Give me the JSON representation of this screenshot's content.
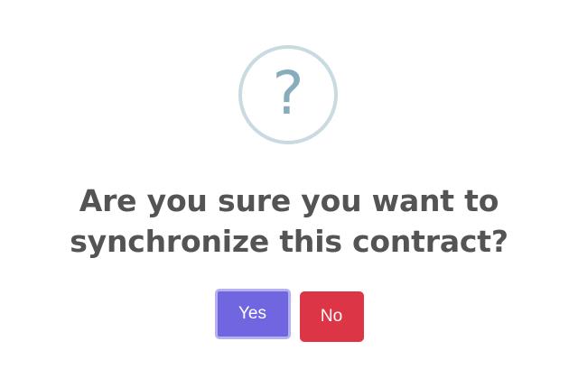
{
  "dialog": {
    "icon": "question-mark-icon",
    "icon_glyph": "?",
    "title": "Are you sure you want to synchronize this contract?",
    "buttons": {
      "confirm_label": "Yes",
      "deny_label": "No"
    },
    "colors": {
      "confirm": "#7066e0",
      "deny": "#dc3545",
      "icon": "#87adbd",
      "icon_border": "#c9dae1",
      "title": "#545454"
    }
  }
}
